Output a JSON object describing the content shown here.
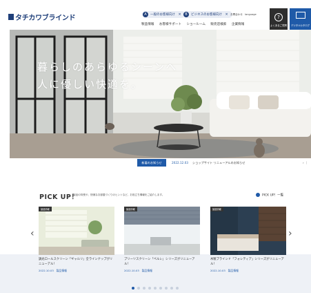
{
  "header": {
    "logo": "タチカワブラインド",
    "pill_1": {
      "num": "A",
      "label": "一般のお客様向け",
      "close": "×"
    },
    "pill_2": {
      "num": "B",
      "label": "ビジネスのお客様向け",
      "close": "×"
    },
    "util_1": "お問合わせ",
    "util_2": "language",
    "nav": [
      "製品情報",
      "お客様サポート",
      "ショールーム",
      "販売店検索",
      "企業情報"
    ],
    "faq_icon": "?",
    "faq_label": "よくあるご質問",
    "catalog_label": "デジタルカタログ"
  },
  "hero": {
    "line_1": "暮らしのあらゆるシーンへ",
    "line_2": "人に優しい快適を。"
  },
  "news": {
    "label": "新着のお知らせ",
    "date": "2022.12.03",
    "title": "ショップサイト リニューアルのお知らせ",
    "next": "› ｜"
  },
  "pickup": {
    "title": "PICK UP！",
    "desc": "製品の特長や、快適なお部屋づくりのヒントなど、お役立ち情報をご紹介します。",
    "list_link": "PICK UP！一覧",
    "prev": "‹",
    "next": "›",
    "cards": [
      {
        "tag": "製品情報",
        "title": "調光ロールスクリーン「ギャルリ」全ラインナップがリニューアル！",
        "date": "2022.10.03",
        "cat": "製品情報"
      },
      {
        "tag": "製品情報",
        "title": "プリーツスクリーン「ペルレ」シリーズがリニューアル！",
        "date": "2022.10.03",
        "cat": "製品情報"
      },
      {
        "tag": "製品情報",
        "title": "木製ブラインド「フォレティア」シリーズがリニューアル！",
        "date": "2022.10.03",
        "cat": "製品情報"
      }
    ]
  },
  "colors": {
    "brand_navy": "#1f3f7a",
    "accent_blue": "#1f5aa8",
    "dark_button": "#2e2e2e"
  }
}
